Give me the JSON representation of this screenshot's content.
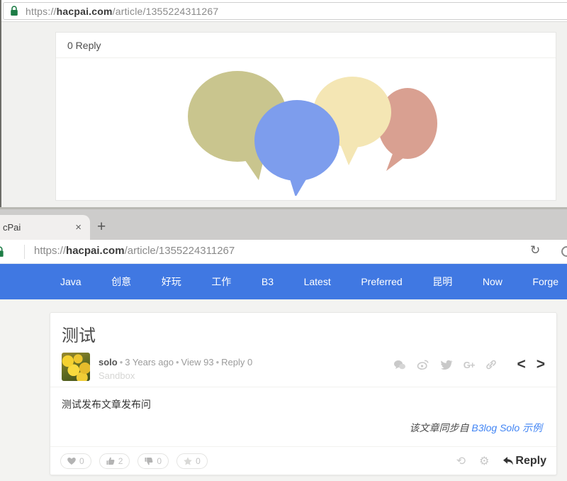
{
  "address": {
    "protocol": "https://",
    "domain": "hacpai.com",
    "path": "/article/1355224311267"
  },
  "window1": {
    "comments_header": "0 Reply"
  },
  "window2": {
    "tab": {
      "label": "cPai",
      "close_glyph": "×",
      "new_tab_glyph": "+"
    },
    "reload_glyph": "↻",
    "nav_items": [
      "Java",
      "创意",
      "好玩",
      "工作",
      "B3",
      "Latest",
      "Preferred",
      "昆明",
      "Now",
      "Forge"
    ],
    "article": {
      "title": "测试",
      "author": "solo",
      "dot": "•",
      "time": "3 Years ago",
      "views": "View 93",
      "reply_count": "Reply 0",
      "badge": "Sandbox",
      "gplus_label": "G+",
      "prev_glyph": "<",
      "next_glyph": ">",
      "body": "测试发布文章发布问",
      "sync_prefix": "该文章同步自 ",
      "sync_link": "B3log Solo 示例",
      "votes": [
        {
          "icon": "heart",
          "count": "0"
        },
        {
          "icon": "thumbs-up",
          "count": "2"
        },
        {
          "icon": "thumbs-down",
          "count": "0"
        },
        {
          "icon": "star",
          "count": "0"
        }
      ],
      "refresh_glyph": "⟲",
      "gear_glyph": "⚙",
      "reply_label": "Reply"
    }
  },
  "colors": {
    "nav_blue": "#4078e2",
    "link_blue": "#4285f4",
    "lock_green": "#1d7d46",
    "bubble_olive": "#c9c58e",
    "bubble_blue": "#7d9ded",
    "bubble_cream": "#f4e6b4",
    "bubble_salmon": "#d9a091",
    "icon_gray": "#c9c9c9",
    "vote_icon_gray": "#b3b3b3",
    "vote_icon_light": "#d9d9d7",
    "dark_text": "#333333"
  }
}
